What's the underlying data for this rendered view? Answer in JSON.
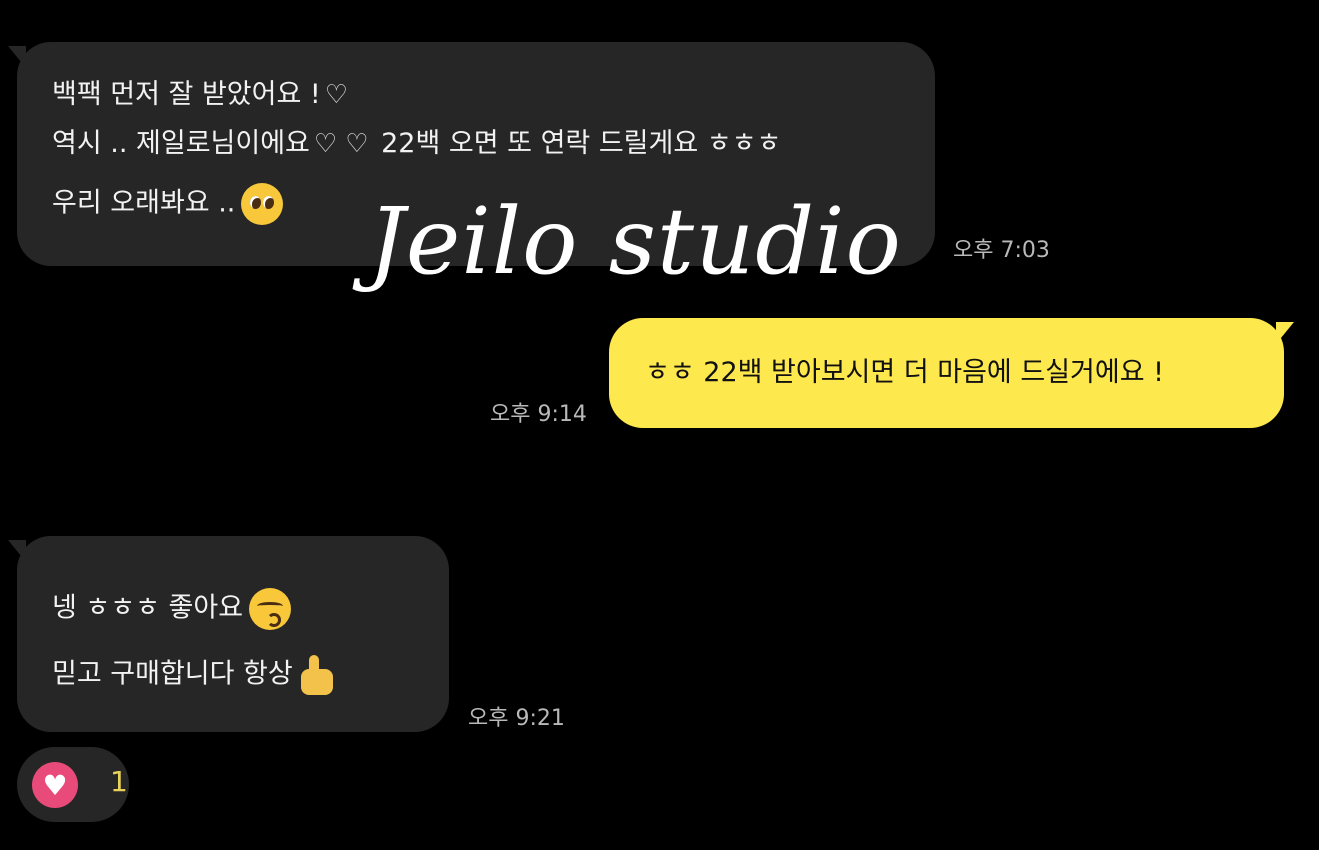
{
  "watermark": "Jeilo studio",
  "messages": [
    {
      "direction": "incoming",
      "lines": [
        "백팩 먼저 잘 받았어요 !",
        "역시 .. 제일로님이에요",
        "22백 오면 또 연락 드릴게요 ㅎㅎㅎ",
        "우리 오래봐요 .."
      ],
      "time": "오후 7:03"
    },
    {
      "direction": "outgoing",
      "lines": [
        "ㅎㅎ 22백 받아보시면 더 마음에 드실거에요 !"
      ],
      "time": "오후 9:14"
    },
    {
      "direction": "incoming",
      "lines": [
        "넹 ㅎㅎㅎ 좋아요",
        "믿고 구매합니다 항상"
      ],
      "time": "오후 9:21",
      "reaction": {
        "icon": "heart-icon",
        "count": "1"
      }
    }
  ],
  "colors": {
    "incoming_bubble": "#262626",
    "outgoing_bubble": "#fde84d",
    "reaction_heart": "#e84b7a"
  }
}
